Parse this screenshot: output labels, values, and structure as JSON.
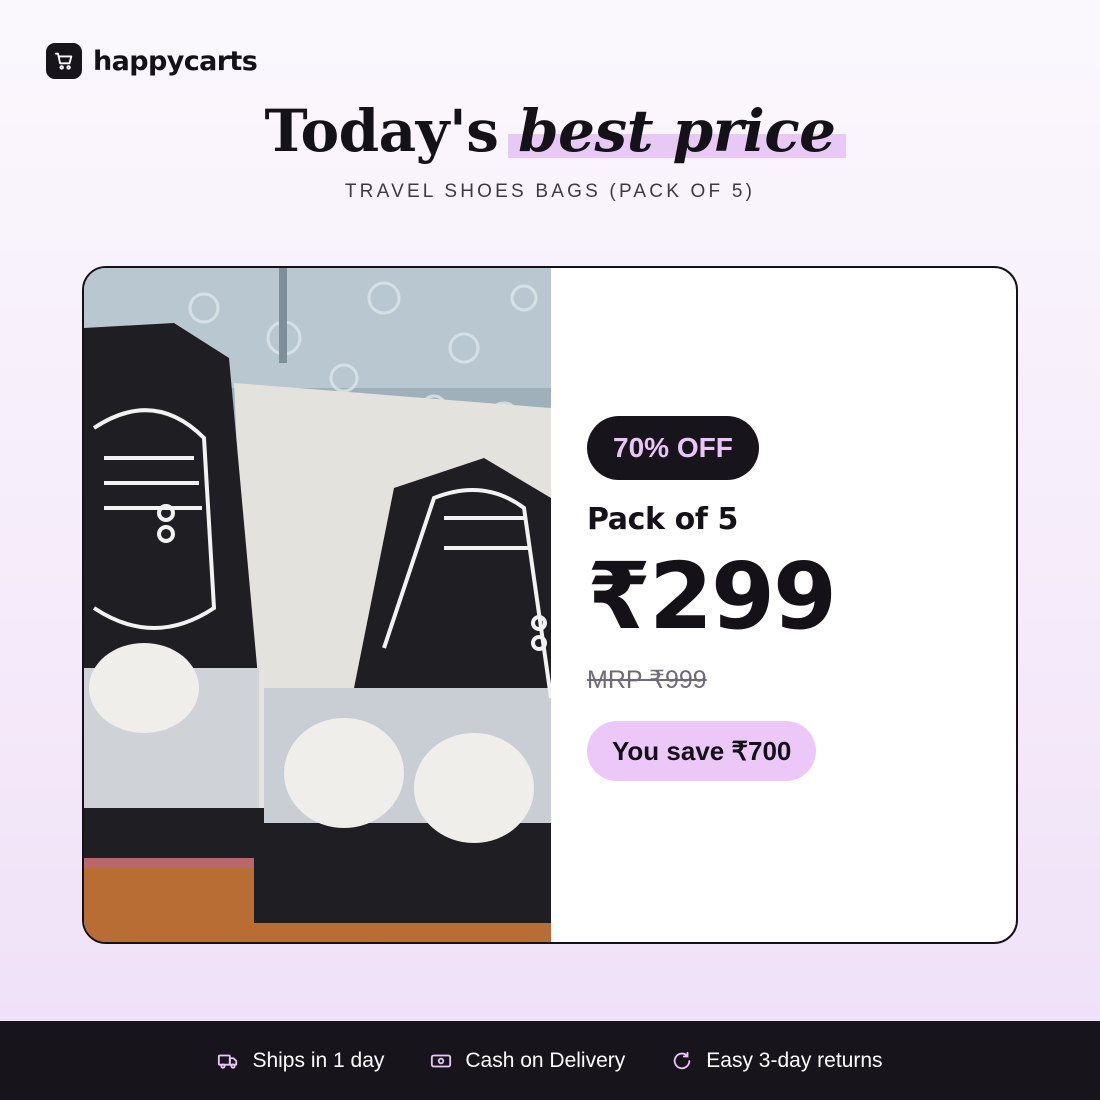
{
  "brand": {
    "name": "happycarts",
    "logo_icon": "shopping-cart-icon"
  },
  "headline": {
    "lead": "Today's",
    "highlight": "best price"
  },
  "subtitle": "TRAVEL SHOES BAGS (PACK OF 5)",
  "product": {
    "discount_badge": "70% OFF",
    "pack_label": "Pack of 5",
    "price": "₹299",
    "mrp": "MRP ₹999",
    "savings": "You save ₹700"
  },
  "footer": {
    "features": [
      {
        "icon": "delivery-truck-icon",
        "label": "Ships in 1 day"
      },
      {
        "icon": "cash-icon",
        "label": "Cash on Delivery"
      },
      {
        "icon": "return-arrow-icon",
        "label": "Easy 3-day returns"
      }
    ]
  },
  "colors": {
    "dark": "#17151b",
    "accent_purple": "#ebc8f8",
    "badge_text": "#e9c6f7",
    "background": "#f5ebfa"
  }
}
